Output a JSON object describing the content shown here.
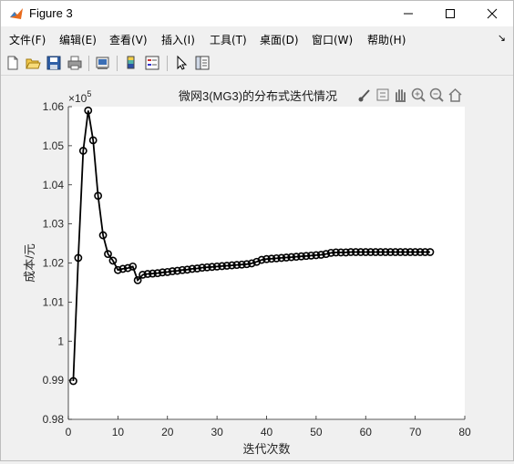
{
  "window": {
    "title": "Figure 3"
  },
  "menu": [
    "文件(F)",
    "编辑(E)",
    "查看(V)",
    "插入(I)",
    "工具(T)",
    "桌面(D)",
    "窗口(W)",
    "帮助(H)"
  ],
  "toolbar_icons": [
    "new-figure-icon",
    "open-file-icon",
    "save-icon",
    "print-icon",
    "print-preview-icon",
    "colorbar-icon",
    "legend-icon",
    "pointer-icon",
    "property-editor-icon"
  ],
  "axes_toolbar_icons": [
    "brush-icon",
    "data-tip-icon",
    "pan-icon",
    "zoom-in-icon",
    "zoom-out-icon",
    "home-icon"
  ],
  "chart_data": {
    "type": "line",
    "title": "微网3(MG3)的分布式迭代情况",
    "xlabel": "迭代次数",
    "ylabel": "成本/元",
    "exponent_label": "×10",
    "exponent_power": "5",
    "xlim": [
      0,
      80
    ],
    "ylim": [
      0.98,
      1.06
    ],
    "xticks": [
      0,
      10,
      20,
      30,
      40,
      50,
      60,
      70,
      80
    ],
    "yticks": [
      0.98,
      0.99,
      1,
      1.01,
      1.02,
      1.03,
      1.04,
      1.05,
      1.06
    ],
    "ytick_labels": [
      "0.98",
      "0.99",
      "1",
      "1.01",
      "1.02",
      "1.03",
      "1.04",
      "1.05",
      "1.06"
    ],
    "marker": "circle",
    "color": "#000000",
    "x": [
      1,
      2,
      3,
      4,
      5,
      6,
      7,
      8,
      9,
      10,
      11,
      12,
      13,
      14,
      15,
      16,
      17,
      18,
      19,
      20,
      21,
      22,
      23,
      24,
      25,
      26,
      27,
      28,
      29,
      30,
      31,
      32,
      33,
      34,
      35,
      36,
      37,
      38,
      39,
      40,
      41,
      42,
      43,
      44,
      45,
      46,
      47,
      48,
      49,
      50,
      51,
      52,
      53,
      54,
      55,
      56,
      57,
      58,
      59,
      60,
      61,
      62,
      63,
      64,
      65,
      66,
      67,
      68,
      69,
      70,
      71,
      72,
      73
    ],
    "y": [
      0.9898,
      1.0213,
      1.0487,
      1.059,
      1.0514,
      1.0372,
      1.0271,
      1.0223,
      1.0206,
      1.0182,
      1.0185,
      1.0187,
      1.0191,
      1.0156,
      1.017,
      1.0172,
      1.0173,
      1.0174,
      1.0176,
      1.0177,
      1.0179,
      1.018,
      1.0182,
      1.0183,
      1.0185,
      1.0186,
      1.0188,
      1.0189,
      1.019,
      1.0191,
      1.0192,
      1.0193,
      1.0194,
      1.0195,
      1.0196,
      1.0197,
      1.0199,
      1.0203,
      1.0208,
      1.021,
      1.0211,
      1.0212,
      1.0213,
      1.0214,
      1.0215,
      1.0216,
      1.0217,
      1.0218,
      1.0219,
      1.022,
      1.0221,
      1.0223,
      1.0226,
      1.0227,
      1.0227,
      1.0227,
      1.0228,
      1.0228,
      1.0228,
      1.0228,
      1.0228,
      1.0228,
      1.0228,
      1.0228,
      1.0228,
      1.0228,
      1.0228,
      1.0228,
      1.0228,
      1.0228,
      1.0228,
      1.0228,
      1.0228
    ]
  }
}
